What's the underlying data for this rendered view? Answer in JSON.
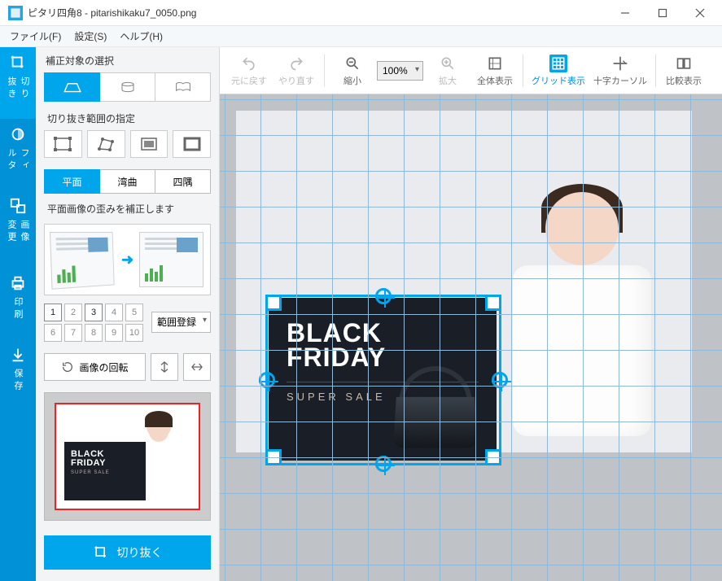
{
  "window": {
    "title": "ピタリ四角8 - pitarishikaku7_0050.png"
  },
  "menu": {
    "file": "ファイル(F)",
    "settings": "設定(S)",
    "help": "ヘルプ(H)"
  },
  "vtabs": {
    "crop": "切り抜き",
    "filter": "フィルタ",
    "resize": "画像変更",
    "print": "印刷",
    "save": "保存"
  },
  "panel": {
    "title": "補正対象の選択",
    "range_title": "切り抜き範囲の指定",
    "mode": {
      "flat": "平面",
      "curved": "湾曲",
      "corners": "四隅"
    },
    "desc": "平面画像の歪みを補正します",
    "nums": {
      "n1": "1",
      "n2": "2",
      "n3": "3",
      "n4": "4",
      "n5": "5",
      "n6": "6",
      "n7": "7",
      "n8": "8",
      "n9": "9",
      "n10": "10"
    },
    "range_register": "範囲登録",
    "rotate": "画像の回転",
    "crop_button": "切り抜く",
    "thumb": {
      "line1": "BLACK",
      "line2": "FRIDAY",
      "sub": "SUPER SALE"
    }
  },
  "toolbar": {
    "undo": "元に戻す",
    "redo": "やり直す",
    "zoom_out": "縮小",
    "zoom_value": "100%",
    "zoom_in": "拡大",
    "fit": "全体表示",
    "grid": "グリッド表示",
    "crosshair": "十字カーソル",
    "compare": "比較表示"
  },
  "canvas": {
    "board": {
      "line1": "BLACK",
      "line2": "FRIDAY",
      "sub": "SUPER SALE"
    }
  },
  "colors": {
    "accent": "#00a6ec"
  }
}
